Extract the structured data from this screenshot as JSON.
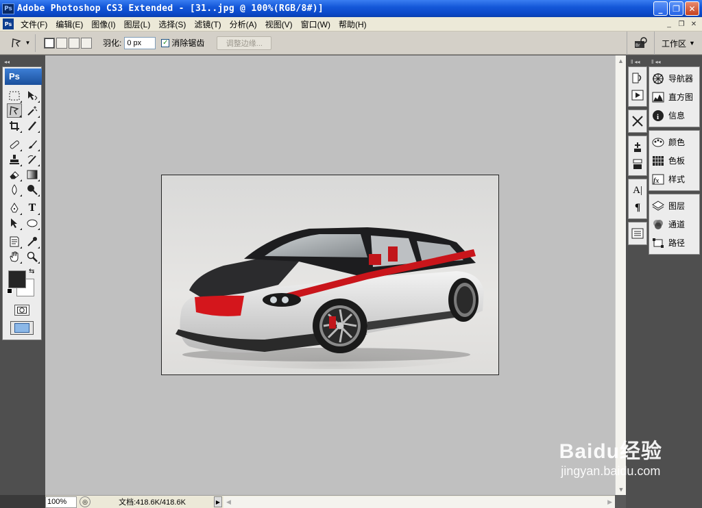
{
  "window": {
    "title": "Adobe Photoshop CS3 Extended - [31..jpg @ 100%(RGB/8#)]",
    "app_badge": "Ps"
  },
  "menu": {
    "app_badge": "Ps",
    "items": [
      "文件(F)",
      "编辑(E)",
      "图像(I)",
      "图层(L)",
      "选择(S)",
      "滤镜(T)",
      "分析(A)",
      "视图(V)",
      "窗口(W)",
      "帮助(H)"
    ]
  },
  "options": {
    "feather_label": "羽化:",
    "feather_value": "0 px",
    "antialias_label": "消除锯齿",
    "antialias_checked": true,
    "refine_edge_label": "调整边缘...",
    "workspace_label": "工作区"
  },
  "toolbox": {
    "logo": "Ps",
    "foreground_color": "#262626",
    "background_color": "#ffffff"
  },
  "status": {
    "zoom": "100%",
    "doc_info": "文档:418.6K/418.6K"
  },
  "panels": {
    "group1": [
      "导航器",
      "直方图",
      "信息"
    ],
    "group2": [
      "颜色",
      "色板",
      "样式"
    ],
    "group3": [
      "图层",
      "通道",
      "路径"
    ]
  },
  "watermark": {
    "brand": "Baidu经验",
    "url": "jingyan.baidu.com"
  }
}
